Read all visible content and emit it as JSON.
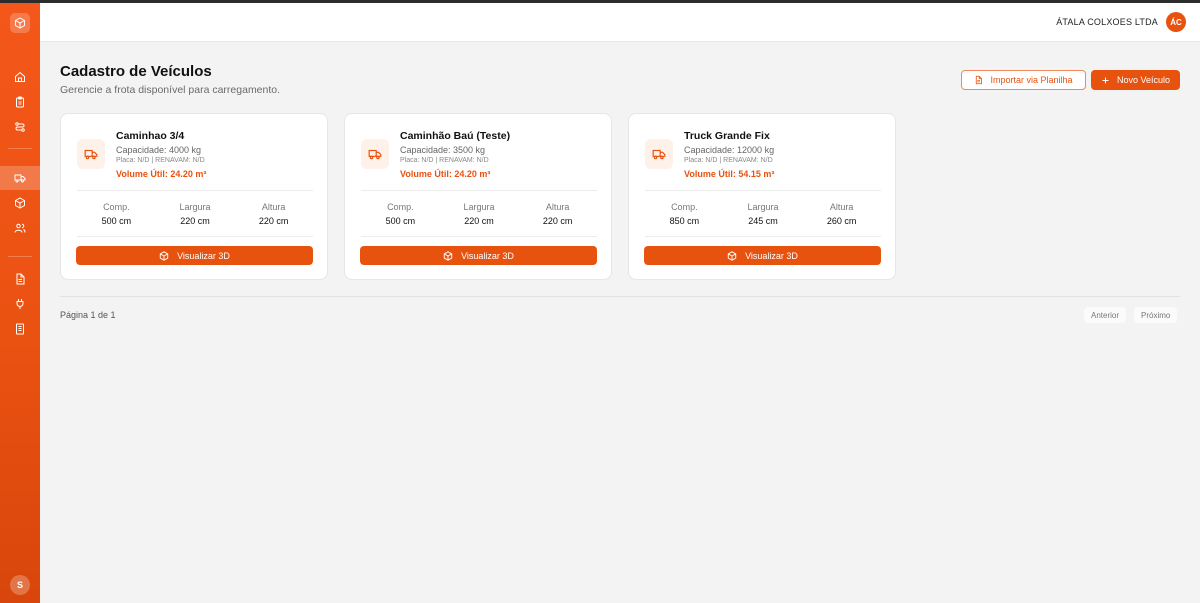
{
  "sidebar": {
    "logo_icon": "package-icon",
    "items": [
      {
        "icon": "home-icon"
      },
      {
        "icon": "clipboard-icon"
      },
      {
        "icon": "route-icon"
      },
      {
        "icon": "truck-icon",
        "active": true
      },
      {
        "icon": "package-icon"
      },
      {
        "icon": "users-icon"
      },
      {
        "icon": "file-icon"
      },
      {
        "icon": "plug-icon"
      },
      {
        "icon": "receipt-icon"
      }
    ],
    "user_initial": "S"
  },
  "header": {
    "company": "ÁTALA COLXOES LTDA",
    "avatar_initials": "ÁC"
  },
  "page": {
    "title": "Cadastro de Veículos",
    "subtitle": "Gerencie a frota disponível para carregamento.",
    "import_label": "Importar via Planilha",
    "new_label": "Novo Veículo"
  },
  "vehicles": [
    {
      "name": "Caminhao 3/4",
      "capacity": "Capacidade: 4000 kg",
      "placa": "Placa: N/D | RENAVAM: N/D",
      "volume": "Volume Útil: 24.20 m³",
      "dims": [
        {
          "label": "Comp.",
          "value": "500 cm"
        },
        {
          "label": "Largura",
          "value": "220 cm"
        },
        {
          "label": "Altura",
          "value": "220 cm"
        }
      ],
      "button": "Visualizar 3D"
    },
    {
      "name": "Caminhão Baú (Teste)",
      "capacity": "Capacidade: 3500 kg",
      "placa": "Placa: N/D | RENAVAM: N/D",
      "volume": "Volume Útil: 24.20 m³",
      "dims": [
        {
          "label": "Comp.",
          "value": "500 cm"
        },
        {
          "label": "Largura",
          "value": "220 cm"
        },
        {
          "label": "Altura",
          "value": "220 cm"
        }
      ],
      "button": "Visualizar 3D"
    },
    {
      "name": "Truck Grande Fix",
      "capacity": "Capacidade: 12000 kg",
      "placa": "Placa: N/D | RENAVAM: N/D",
      "volume": "Volume Útil: 54.15 m³",
      "dims": [
        {
          "label": "Comp.",
          "value": "850 cm"
        },
        {
          "label": "Largura",
          "value": "245 cm"
        },
        {
          "label": "Altura",
          "value": "260 cm"
        }
      ],
      "button": "Visualizar 3D"
    }
  ],
  "pagination": {
    "text": "Página 1 de 1",
    "prev": "Anterior",
    "next": "Próximo"
  },
  "colors": {
    "accent": "#e8520f",
    "sidebar": "#f4571a"
  }
}
